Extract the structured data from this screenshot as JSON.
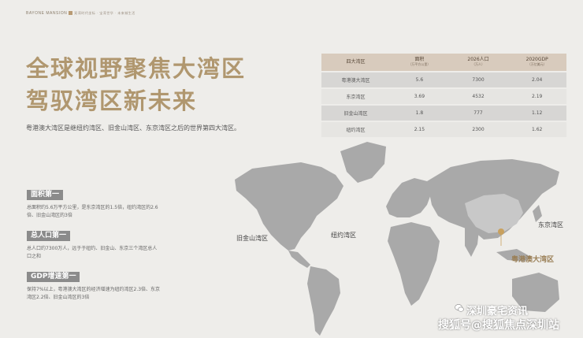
{
  "brand": {
    "name": "BAYONE MANSION",
    "tagline": "双湾时代坐标 · 宝湾世华 · 未来城生活"
  },
  "title": {
    "line1": "全球视野聚焦大湾区",
    "line2": "驾驭湾区新未来"
  },
  "intro": "粤港澳大湾区是继纽约湾区、旧金山湾区、东京湾区之后的世界第四大湾区。",
  "table": {
    "headers": [
      {
        "main": "四大湾区",
        "sub": ""
      },
      {
        "main": "面积",
        "sub": "（万平方公里）"
      },
      {
        "main": "2026人口",
        "sub": "（万人）"
      },
      {
        "main": "2020GDP",
        "sub": "（万亿美元）"
      }
    ],
    "rows": [
      [
        "粤港澳大湾区",
        "5.6",
        "7300",
        "2.04"
      ],
      [
        "东京湾区",
        "3.69",
        "4532",
        "2.19"
      ],
      [
        "旧金山湾区",
        "1.8",
        "777",
        "1.12"
      ],
      [
        "纽约湾区",
        "2.15",
        "2300",
        "1.62"
      ]
    ]
  },
  "stats": [
    {
      "label": "面积第一",
      "desc": "总面积约5.6万平方公里，是东京湾区的1.5倍，纽约湾区的2.6倍、旧金山湾区的3倍"
    },
    {
      "label": "总人口第一",
      "desc": "总人口约7300万人，远于于纽约、旧金山、东京三个湾区总人口之和"
    },
    {
      "label": "GDP增速第一",
      "desc": "保持7%以上，粤港澳大湾区的经济增速为纽约湾区2.3倍、东京湾区2.2倍、旧金山湾区的3倍"
    }
  ],
  "map_labels": {
    "sf": "旧金山湾区",
    "ny": "纽约湾区",
    "tokyo": "东京湾区",
    "gba": "粤港澳大湾区"
  },
  "watermark": {
    "line1": "深圳豪宅资讯",
    "line2": "搜狐号@搜狐焦点深圳站"
  },
  "colors": {
    "accent": "#b0976f",
    "map_land": "#a9a9a9",
    "china_highlight": "#c8c8c8",
    "marker": "#c9a15e"
  }
}
